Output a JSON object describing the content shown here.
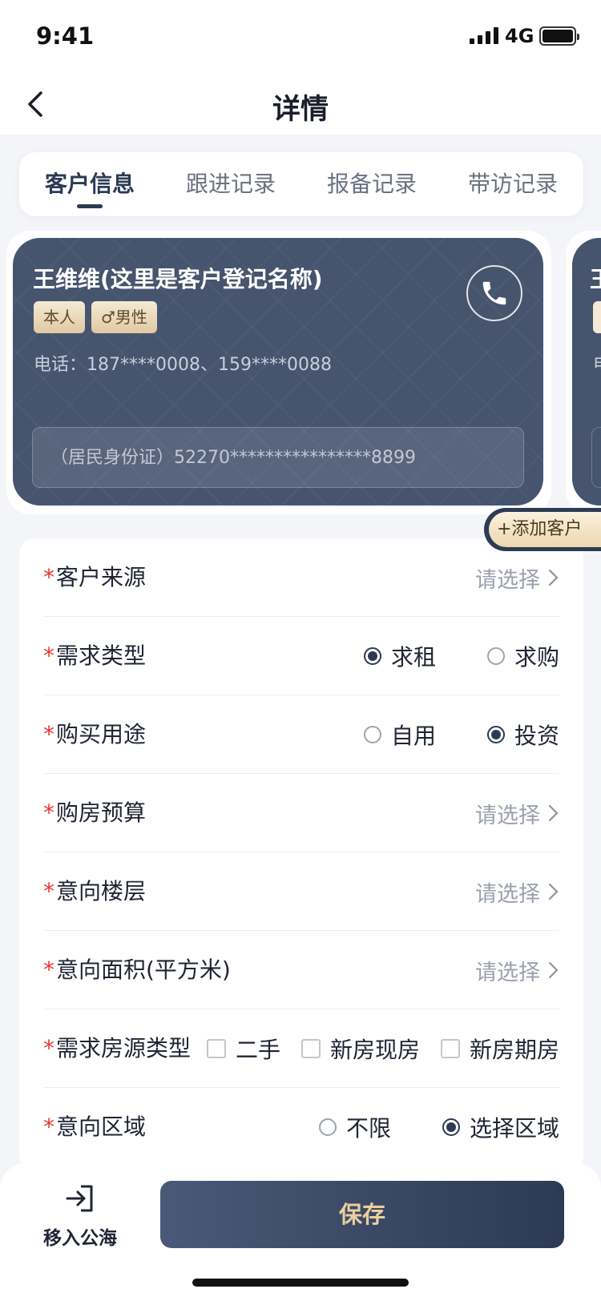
{
  "status_bar": {
    "time": "9:41",
    "network": "4G"
  },
  "nav": {
    "title": "详情"
  },
  "tabs": [
    {
      "label": "客户信息",
      "active": true
    },
    {
      "label": "跟进记录",
      "active": false
    },
    {
      "label": "报备记录",
      "active": false
    },
    {
      "label": "带访记录",
      "active": false
    }
  ],
  "customer_card": {
    "name": "王维维(这里是客户登记名称)",
    "tag_relation": "本人",
    "tag_gender": "♂男性",
    "phone": "电话：187****0008、159****0088",
    "id_card": "（居民身份证）52270****************8899"
  },
  "peek_card": {
    "name_char": "王",
    "phone_char": "电"
  },
  "add_customer": {
    "label": "+添加客户"
  },
  "form": {
    "source": {
      "label": "客户来源",
      "placeholder": "请选择"
    },
    "demand_type": {
      "label": "需求类型",
      "options": [
        "求租",
        "求购"
      ],
      "selected": "求租"
    },
    "purpose": {
      "label": "购买用途",
      "options": [
        "自用",
        "投资"
      ],
      "selected": "投资"
    },
    "budget": {
      "label": "购房预算",
      "placeholder": "请选择"
    },
    "floor": {
      "label": "意向楼层",
      "placeholder": "请选择"
    },
    "area": {
      "label": "意向面积(平方米)",
      "placeholder": "请选择"
    },
    "house_type": {
      "label": "需求房源类型",
      "options": [
        "二手",
        "新房现房",
        "新房期房"
      ]
    },
    "region": {
      "label": "意向区域",
      "options": [
        "不限",
        "选择区域"
      ],
      "selected": "选择区域"
    }
  },
  "bottom": {
    "move_label": "移入公海",
    "save_label": "保存"
  },
  "colors": {
    "primary": "#2c3a52",
    "card": "#46546e",
    "gold": "#e9cf9e",
    "required": "#e53935"
  }
}
